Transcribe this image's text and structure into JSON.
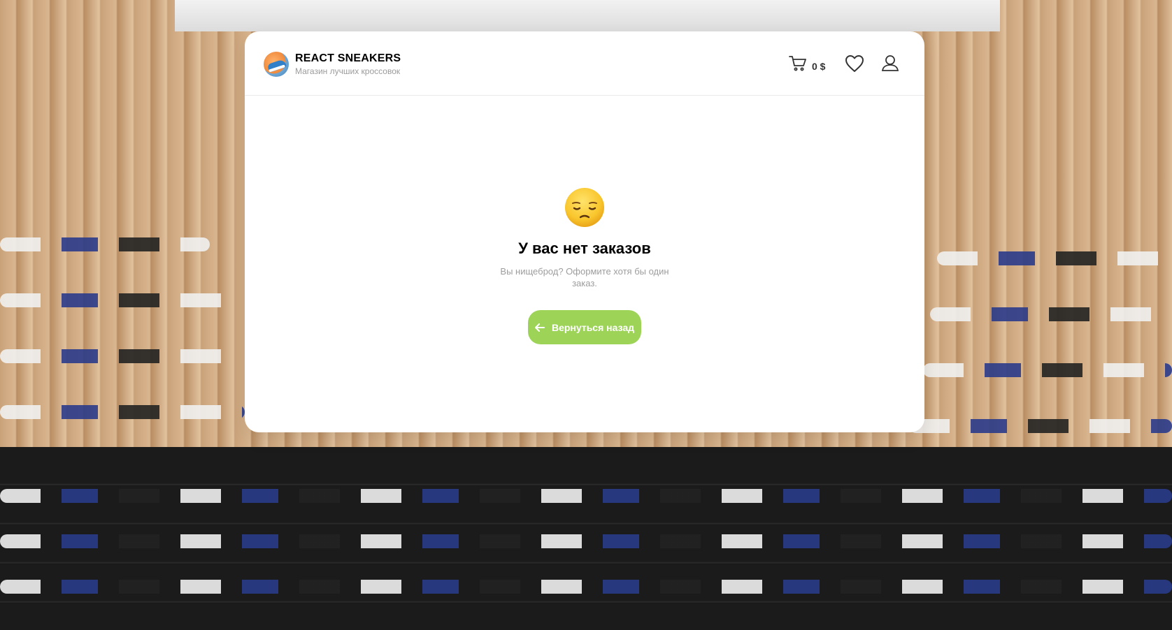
{
  "header": {
    "brand_title": "REACT SNEAKERS",
    "brand_subtitle": "Магазин лучших кроссовок",
    "cart_total": "0 $"
  },
  "empty_state": {
    "title": "У вас нет заказов",
    "description": "Вы нищеброд? Оформите хотя бы один заказ.",
    "back_button_label": "Вернуться назад"
  },
  "icons": {
    "logo": "sneaker-logo-icon",
    "cart": "cart-icon",
    "favorites": "heart-icon",
    "profile": "user-icon",
    "emoji": "pensive-face-emoji-icon",
    "back_arrow": "arrow-left-icon"
  },
  "colors": {
    "accent_button": "#9dd458",
    "card_background": "#ffffff",
    "subtitle_text": "#9b9b9b"
  }
}
